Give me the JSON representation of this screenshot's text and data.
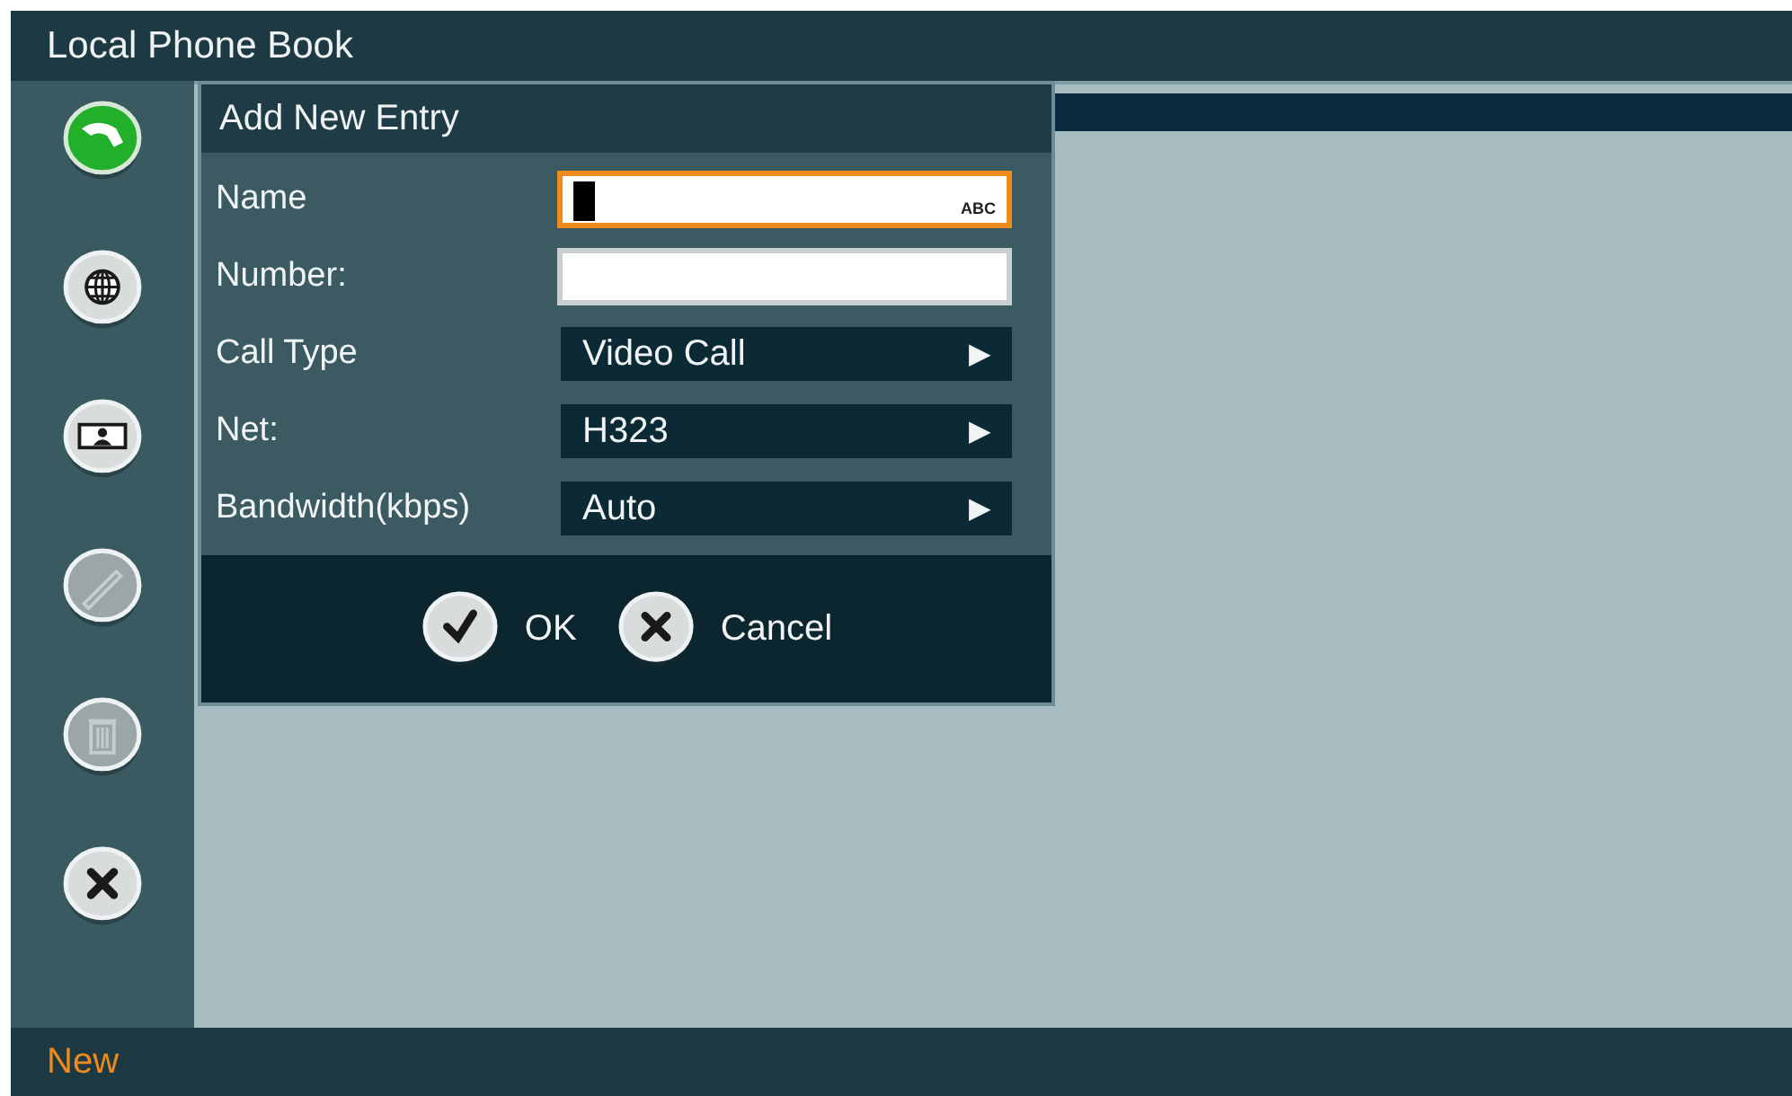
{
  "window": {
    "title": "Local Phone Book"
  },
  "sidebar": {
    "buttons": [
      {
        "kind": "call",
        "disabled": false
      },
      {
        "kind": "globe",
        "disabled": false
      },
      {
        "kind": "contact",
        "disabled": false
      },
      {
        "kind": "edit",
        "disabled": true
      },
      {
        "kind": "delete",
        "disabled": true
      },
      {
        "kind": "close",
        "disabled": false
      }
    ]
  },
  "dialog": {
    "title": "Add New Entry",
    "fields": [
      {
        "kind": "text",
        "label": "Name",
        "focused": true,
        "input_mode": "ABC"
      },
      {
        "kind": "text",
        "label": "Number:",
        "focused": false
      },
      {
        "kind": "select",
        "label": "Call Type",
        "value": "Video Call",
        "arrow": "▶"
      },
      {
        "kind": "select",
        "label": "Net:",
        "value": "H323",
        "arrow": "▶"
      },
      {
        "kind": "select",
        "label": "Bandwidth(kbps)",
        "value": "Auto",
        "arrow": "▶"
      }
    ],
    "buttons": [
      {
        "kind": "ok",
        "label": "OK"
      },
      {
        "kind": "cancel",
        "label": "Cancel"
      }
    ]
  },
  "status_bar": {
    "text": "New"
  }
}
